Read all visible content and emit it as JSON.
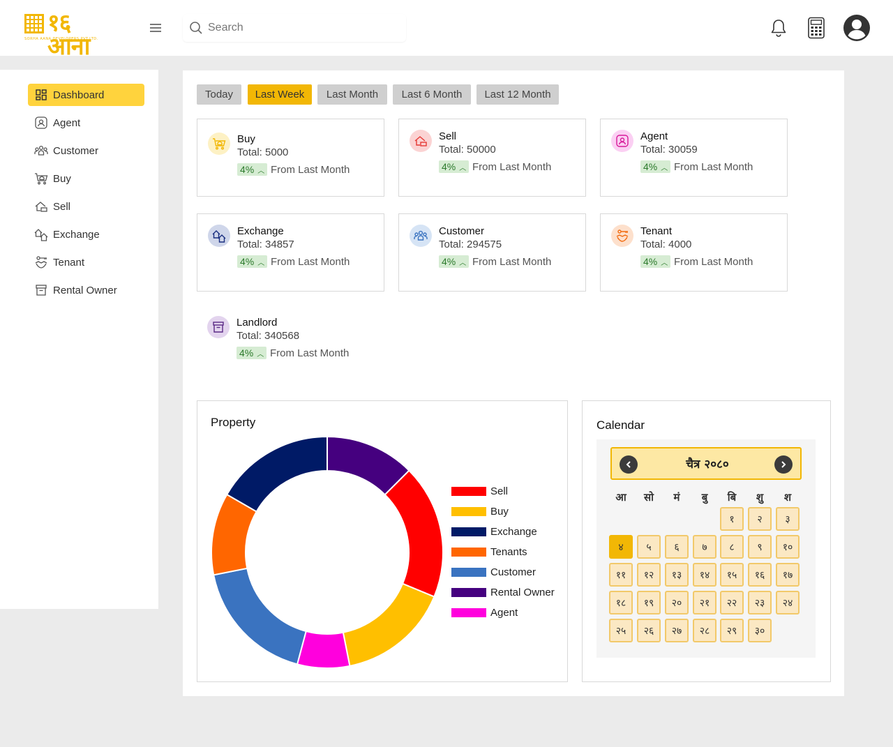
{
  "brand": {
    "logo_text": "१६ आना",
    "logo_sub": "SORHA AANA DEVELOPERS PVT.LTD.",
    "color": "#f2b705"
  },
  "header": {
    "search_placeholder": "Search",
    "icons": [
      "menu-icon",
      "search-icon",
      "bell-icon",
      "calculator-icon",
      "user-avatar-icon"
    ]
  },
  "sidebar": {
    "items": [
      {
        "label": "Dashboard",
        "icon": "dashboard-icon",
        "active": true
      },
      {
        "label": "Agent",
        "icon": "agent-icon",
        "active": false
      },
      {
        "label": "Customer",
        "icon": "customer-icon",
        "active": false
      },
      {
        "label": "Buy",
        "icon": "buy-icon",
        "active": false
      },
      {
        "label": "Sell",
        "icon": "sell-icon",
        "active": false
      },
      {
        "label": "Exchange",
        "icon": "exchange-icon",
        "active": false
      },
      {
        "label": "Tenant",
        "icon": "tenant-icon",
        "active": false
      },
      {
        "label": "Rental Owner",
        "icon": "rental-owner-icon",
        "active": false
      }
    ]
  },
  "filters": [
    {
      "label": "Today",
      "active": false
    },
    {
      "label": "Last Week",
      "active": true
    },
    {
      "label": "Last Month",
      "active": false
    },
    {
      "label": "Last 6 Month",
      "active": false
    },
    {
      "label": "Last 12 Month",
      "active": false
    }
  ],
  "stats": [
    {
      "title": "Buy",
      "total": "Total: 5000",
      "change": "4%",
      "from": "From Last Month",
      "icon": "cart-icon",
      "icon_bg": "#fdf1c4",
      "icon_color": "#f2b705"
    },
    {
      "title": "Sell",
      "total": "Total: 50000",
      "change": "4%",
      "from": "From Last Month",
      "icon": "house-sale-icon",
      "icon_bg": "#fbd3d3",
      "icon_color": "#e53935"
    },
    {
      "title": "Agent",
      "total": "Total: 30059",
      "change": "4%",
      "from": "From Last Month",
      "icon": "agent-icon",
      "icon_bg": "#fbd0f3",
      "icon_color": "#d81b9a"
    },
    {
      "title": "Exchange",
      "total": "Total: 34857",
      "change": "4%",
      "from": "From Last Month",
      "icon": "exchange-icon",
      "icon_bg": "#cfd6ea",
      "icon_color": "#1a2f80"
    },
    {
      "title": "Customer",
      "total": "Total: 294575",
      "change": "4%",
      "from": "From Last Month",
      "icon": "customer-icon",
      "icon_bg": "#d6e4f5",
      "icon_color": "#3a73c0"
    },
    {
      "title": "Tenant",
      "total": "Total: 4000",
      "change": "4%",
      "from": "From Last Month",
      "icon": "tenant-icon",
      "icon_bg": "#fde0cc",
      "icon_color": "#f26b0f"
    },
    {
      "title": "Landlord",
      "total": "Total: 340568",
      "change": "4%",
      "from": "From Last Month",
      "icon": "landlord-icon",
      "icon_bg": "#e3d4ee",
      "icon_color": "#5b2a86"
    }
  ],
  "property": {
    "title": "Property"
  },
  "chart_data": {
    "type": "pie",
    "title": "Property",
    "categories": [
      "Sell",
      "Buy",
      "Exchange",
      "Tenants",
      "Customer",
      "Rental Owner",
      "Agent"
    ],
    "values": [
      18,
      15,
      16,
      11,
      17,
      12,
      7
    ],
    "colors": [
      "#ff0000",
      "#ffbf00",
      "#001a66",
      "#ff6600",
      "#3a73c0",
      "#45007f",
      "#ff00dd"
    ],
    "legend": "right",
    "donut": true
  },
  "calendar": {
    "title": "Calendar",
    "month": "चैत्र २०८०",
    "weekdays": [
      "आ",
      "सो",
      "मं",
      "बु",
      "बि",
      "शु",
      "श"
    ],
    "first_weekday_index": 4,
    "days": [
      "१",
      "२",
      "३",
      "४",
      "५",
      "६",
      "७",
      "८",
      "९",
      "१०",
      "११",
      "१२",
      "१३",
      "१४",
      "१५",
      "१६",
      "१७",
      "१८",
      "१९",
      "२०",
      "२१",
      "२२",
      "२३",
      "२४",
      "२५",
      "२६",
      "२७",
      "२८",
      "२९",
      "३०"
    ],
    "today": "४"
  }
}
